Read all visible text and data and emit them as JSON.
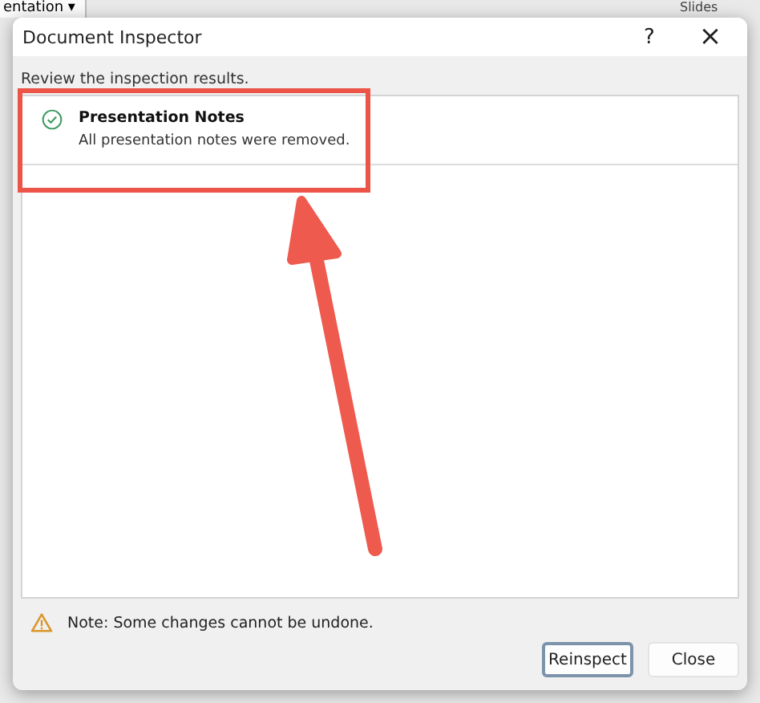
{
  "background": {
    "ribbon_tab": "entation ▾",
    "ribbon_label": "Slides"
  },
  "window": {
    "title": "Document Inspector",
    "help": "?",
    "close": "×"
  },
  "instruction": "Review the inspection results.",
  "results": [
    {
      "title": "Presentation Notes",
      "detail": "All presentation notes were removed.",
      "passed": true
    }
  ],
  "note": "Note: Some changes cannot be undone.",
  "buttons": [
    {
      "label": "Reinspect",
      "default": true
    },
    {
      "label": "Close",
      "default": false
    }
  ],
  "highlight": {
    "box": true,
    "arrow": true
  }
}
